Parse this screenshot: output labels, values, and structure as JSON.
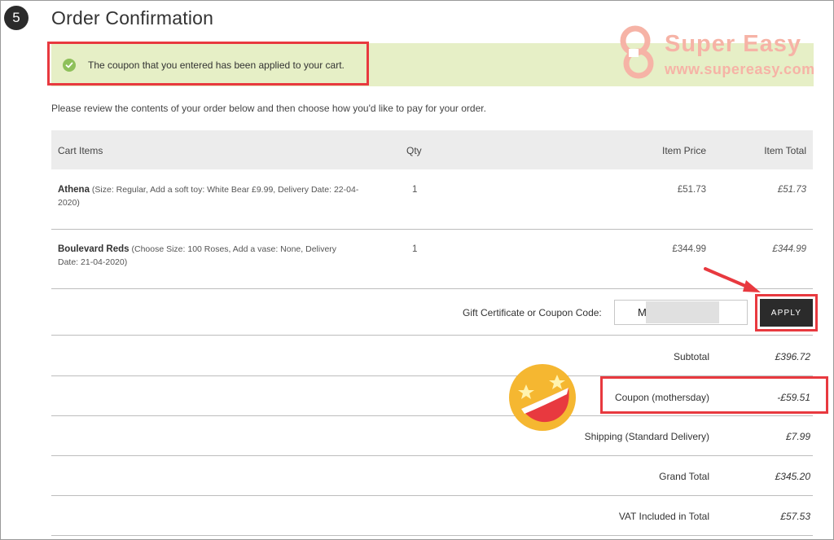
{
  "step": {
    "number": "5"
  },
  "page": {
    "title": "Order Confirmation",
    "success_message": "The coupon that you entered has been applied to your cart.",
    "intro": "Please review the contents of your order below and then choose how you'd like to pay for your order."
  },
  "cart": {
    "headers": {
      "items": "Cart Items",
      "qty": "Qty",
      "item_price": "Item Price",
      "item_total": "Item Total"
    },
    "rows": [
      {
        "name": "Athena",
        "options": "(Size: Regular, Add a soft toy: White Bear £9.99, Delivery Date: 22-04-2020)",
        "qty": "1",
        "price": "£51.73",
        "total": "£51.73"
      },
      {
        "name": "Boulevard Reds",
        "options": "(Choose Size: 100 Roses, Add a vase: None, Delivery Date: 21-04-2020)",
        "qty": "1",
        "price": "£344.99",
        "total": "£344.99"
      }
    ]
  },
  "coupon": {
    "label": "Gift Certificate or Coupon Code:",
    "value": "M",
    "apply_label": "APPLY"
  },
  "summary": [
    {
      "label": "Subtotal",
      "value": "£396.72"
    },
    {
      "label": "Coupon (mothersday)",
      "value": "-£59.51"
    },
    {
      "label": "Shipping (Standard Delivery)",
      "value": "£7.99"
    },
    {
      "label": "Grand Total",
      "value": "£345.20"
    },
    {
      "label": "VAT Included in Total",
      "value": "£57.53"
    }
  ],
  "watermark": {
    "brand": "Super Easy",
    "url": "www.supereasy.com"
  },
  "colors": {
    "highlight": "#e8393f",
    "success_bg": "#e6efc6",
    "success_check": "#8ec05a",
    "button_bg": "#2b2b2b",
    "emoji": "#f5b731"
  }
}
